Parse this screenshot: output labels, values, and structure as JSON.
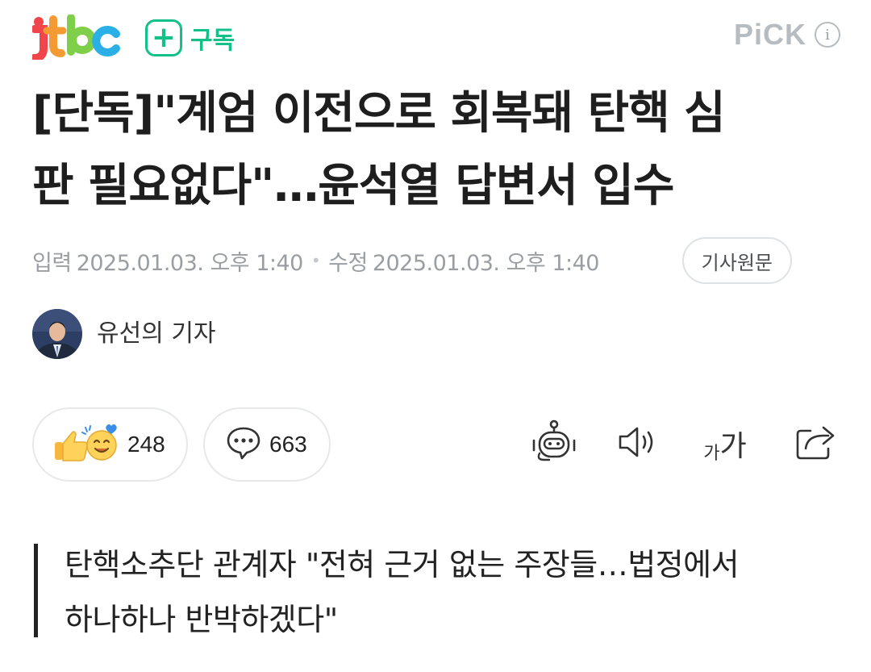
{
  "header": {
    "logo_text": "jtbc",
    "subscribe_label": "구독",
    "pick_label": "PiCK",
    "info_glyph": "i"
  },
  "article": {
    "headline_line1": "[단독]\"계엄 이전으로 회복돼 탄핵 심",
    "headline_line2": "판 필요없다\"…윤석열 답변서 입수",
    "input_label": "입력",
    "input_date": "2025.01.03. 오후 1:40",
    "edit_label": "수정",
    "edit_date": "2025.01.03. 오후 1:40",
    "original_link_label": "기사원문",
    "reporter": "유선의 기자",
    "subtitle_line1": "탄핵소추단 관계자 \"전혀 근거 없는 주장들…법정에서",
    "subtitle_line2": "하나하나 반박하겠다\""
  },
  "reactions": {
    "like_count": "248",
    "comment_count": "663"
  },
  "tools": {
    "font_small": "가",
    "font_large": "가"
  },
  "colors": {
    "brand_green": "#13c08a",
    "pick_gray": "#b7bcc1",
    "meta_gray": "#9a9ea3"
  },
  "icons": [
    "plus-icon",
    "info-icon",
    "like-emoji-icon",
    "comment-icon",
    "summary-bot-icon",
    "speaker-icon",
    "font-size-icon",
    "share-icon"
  ]
}
